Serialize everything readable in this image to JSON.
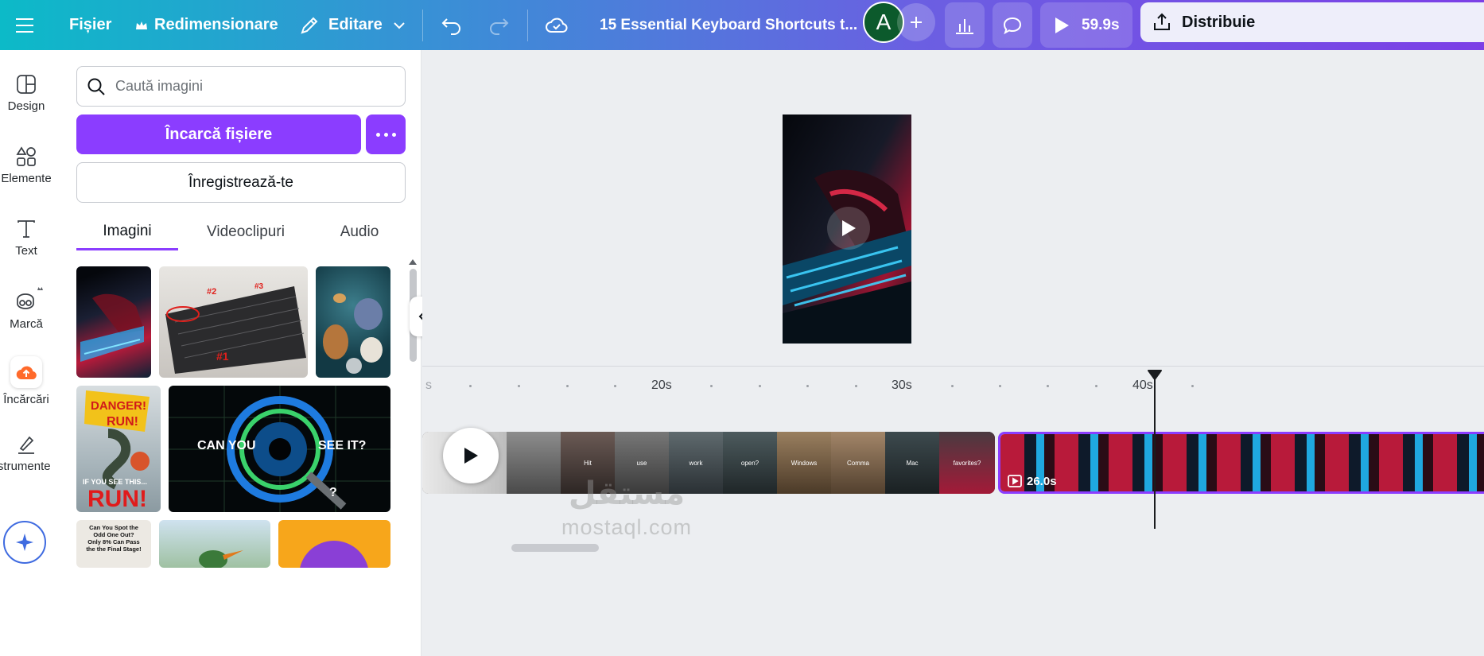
{
  "topbar": {
    "menu_icon": "hamburger-icon",
    "file_label": "Fișier",
    "resize_label": "Redimensionare",
    "edit_label": "Editare",
    "title": "15 Essential Keyboard Shortcuts t...",
    "avatar_initial": "A",
    "play_time": "59.9s",
    "share_label": "Distribuie"
  },
  "rail": {
    "items": [
      {
        "label": "Design",
        "icon": "layout-icon"
      },
      {
        "label": "Elemente",
        "icon": "shapes-icon"
      },
      {
        "label": "Text",
        "icon": "text-icon"
      },
      {
        "label": "Marcă",
        "icon": "brand-icon"
      },
      {
        "label": "Încărcări",
        "icon": "upload-cloud-icon"
      },
      {
        "label": "Instrumente",
        "icon": "tools-icon"
      }
    ]
  },
  "panel": {
    "search_placeholder": "Caută imagini",
    "upload_label": "Încarcă fișiere",
    "record_label": "Înregistrează-te",
    "tabs": [
      "Imagini",
      "Videoclipuri",
      "Audio"
    ],
    "active_tab": "Imagini",
    "thumbs": [
      {
        "caption": ""
      },
      {
        "caption": "#1 #2 #3"
      },
      {
        "caption": ""
      },
      {
        "caption": "DANGER! RUN! IF YOU SEE THIS... RUN!"
      },
      {
        "caption": "CAN YOU SEE IT? ?"
      },
      {
        "caption": "Can You Spot the Odd One Out? Only 8% Can Pass the the Final Stage!"
      }
    ],
    "thumb_texts": {
      "kb_1": "#1",
      "kb_2": "#2",
      "kb_3": "#3",
      "danger_top": "DANGER!",
      "danger_run": "RUN!",
      "danger_if": "IF YOU SEE THIS...",
      "danger_run2": "RUN!",
      "eye_left": "CAN YOU",
      "eye_right": "SEE IT?",
      "eye_q": "?",
      "odd": [
        "Can You Spot the",
        "Odd One Out?",
        "Only 8% Can Pass",
        "the the Final Stage!"
      ]
    }
  },
  "timeline": {
    "ruler": [
      "20s",
      "30s",
      "40s"
    ],
    "clip1_captions": [
      "Hit",
      "use",
      "work",
      "open?",
      "Windows",
      "Comma",
      "Mac",
      "favorites?"
    ],
    "clip2_duration": "26.0s"
  },
  "watermark": {
    "arabic": "مستقل",
    "latin": "mostaql.com"
  },
  "colors": {
    "accent": "#8b3dff",
    "avatar": "#0c5a2c"
  }
}
